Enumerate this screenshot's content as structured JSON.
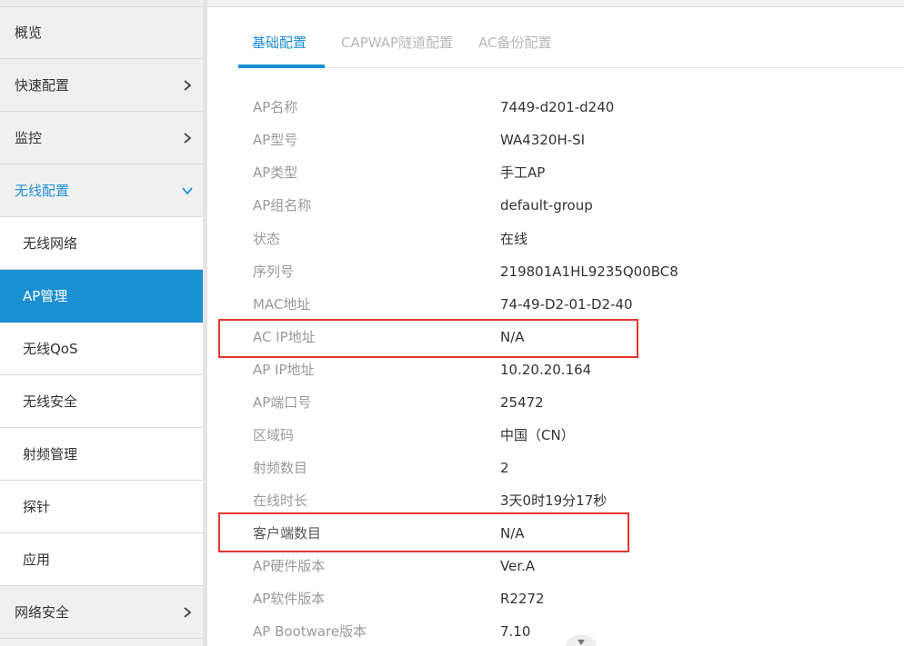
{
  "sidebar": {
    "items": [
      {
        "label": "概览"
      },
      {
        "label": "快速配置"
      },
      {
        "label": "监控"
      },
      {
        "label": "无线配置"
      },
      {
        "label": "网络安全"
      }
    ],
    "subitems": [
      {
        "label": "无线网络"
      },
      {
        "label": "AP管理"
      },
      {
        "label": "无线QoS"
      },
      {
        "label": "无线安全"
      },
      {
        "label": "射频管理"
      },
      {
        "label": "探针"
      },
      {
        "label": "应用"
      }
    ],
    "active_subitem": "AP管理",
    "expanded_item": "无线配置"
  },
  "tabs": [
    {
      "label": "基础配置"
    },
    {
      "label": "CAPWAP隧道配置"
    },
    {
      "label": "AC备份配置"
    }
  ],
  "active_tab": "基础配置",
  "details": [
    {
      "key": "AP名称",
      "value": "7449-d201-d240"
    },
    {
      "key": "AP型号",
      "value": "WA4320H-SI"
    },
    {
      "key": "AP类型",
      "value": "手工AP"
    },
    {
      "key": "AP组名称",
      "value": "default-group"
    },
    {
      "key": "状态",
      "value": "在线"
    },
    {
      "key": "序列号",
      "value": "219801A1HL9235Q00BC8"
    },
    {
      "key": "MAC地址",
      "value": "74-49-D2-01-D2-40"
    },
    {
      "key": "AC IP地址",
      "value": "N/A"
    },
    {
      "key": "AP IP地址",
      "value": "10.20.20.164"
    },
    {
      "key": "AP端口号",
      "value": "25472"
    },
    {
      "key": "区域码",
      "value": "中国（CN）"
    },
    {
      "key": "射频数目",
      "value": "2"
    },
    {
      "key": "在线时长",
      "value": "3天0时19分17秒"
    },
    {
      "key": "客户端数目",
      "value": "N/A"
    },
    {
      "key": "AP硬件版本",
      "value": "Ver.A"
    },
    {
      "key": "AP软件版本",
      "value": "R2272"
    },
    {
      "key": "AP Bootware版本",
      "value": "7.10"
    }
  ],
  "colors": {
    "accent": "#1e90d5",
    "highlight": "#e3372f",
    "sidebar_bg": "#f0f0f0"
  }
}
